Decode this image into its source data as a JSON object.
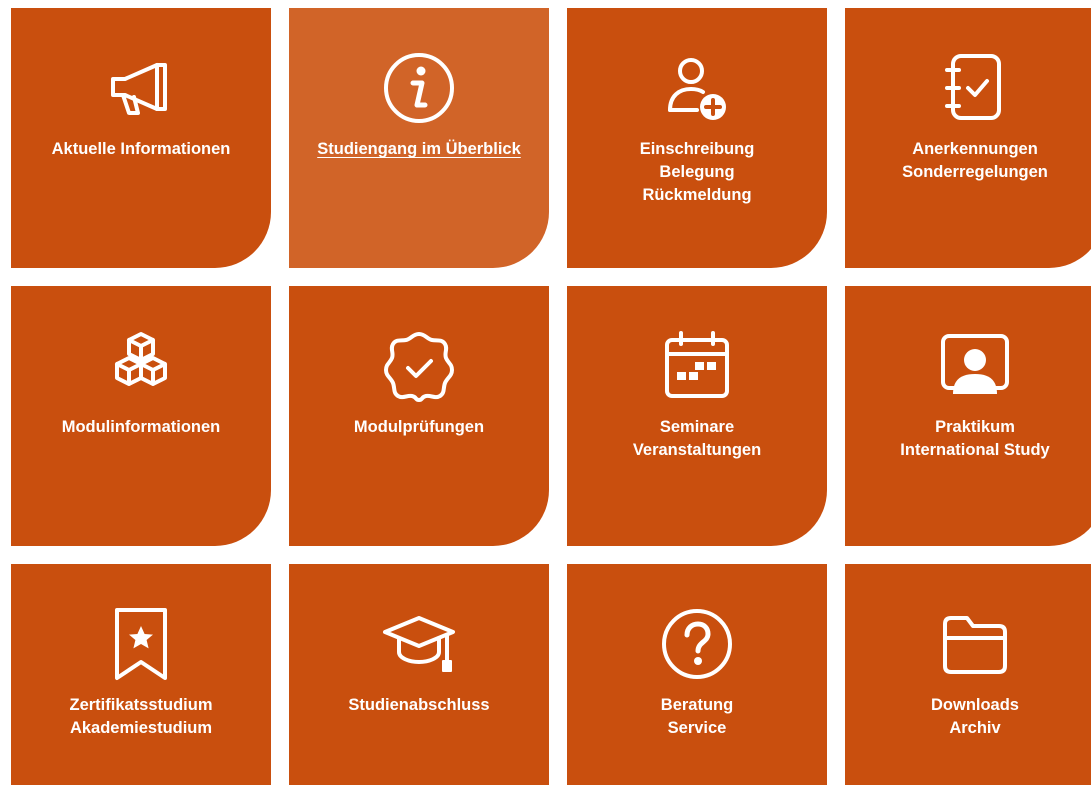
{
  "tiles": [
    {
      "lines": [
        "Aktuelle Informationen"
      ],
      "icon": "megaphone-icon",
      "active": false
    },
    {
      "lines": [
        "Studiengang im Überblick"
      ],
      "icon": "info-icon",
      "active": true
    },
    {
      "lines": [
        "Einschreibung",
        "Belegung",
        "Rückmeldung"
      ],
      "icon": "user-add-icon",
      "active": false
    },
    {
      "lines": [
        "Anerkennungen",
        "Sonderregelungen"
      ],
      "icon": "checklist-notebook-icon",
      "active": false
    },
    {
      "lines": [
        "Modulinformationen"
      ],
      "icon": "cubes-icon",
      "active": false
    },
    {
      "lines": [
        "Modulprüfungen"
      ],
      "icon": "badge-check-icon",
      "active": false
    },
    {
      "lines": [
        "Seminare",
        "Veranstaltungen"
      ],
      "icon": "calendar-icon",
      "active": false
    },
    {
      "lines": [
        "Praktikum",
        "International Study"
      ],
      "icon": "presenter-icon",
      "active": false
    },
    {
      "lines": [
        "Zertifikatsstudium",
        "Akademiestudium"
      ],
      "icon": "bookmark-star-icon",
      "active": false
    },
    {
      "lines": [
        "Studienabschluss"
      ],
      "icon": "graduation-cap-icon",
      "active": false
    },
    {
      "lines": [
        "Beratung",
        "Service"
      ],
      "icon": "question-icon",
      "active": false
    },
    {
      "lines": [
        "Downloads",
        "Archiv"
      ],
      "icon": "folder-icon",
      "active": false
    }
  ],
  "colors": {
    "tile": "#c94f0e",
    "tile_active": "#d16428",
    "text": "#ffffff"
  }
}
